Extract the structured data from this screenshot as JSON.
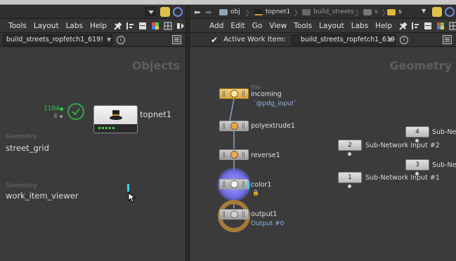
{
  "left_pane": {
    "menu": [
      "Tools",
      "Layout",
      "Labs",
      "Help"
    ],
    "network_path": "build_streets_ropfetch1_619!",
    "context_title": "Objects",
    "nodes": [
      {
        "context": "Geometry",
        "name": "street_grid"
      },
      {
        "context": "Geometry",
        "name": "work_item_viewer"
      }
    ],
    "topnet": {
      "name": "topnet1",
      "count_green": "1184",
      "count_grey": "4"
    }
  },
  "right_pane": {
    "breadcrumbs": [
      "obj",
      "topnet1",
      "build_streets",
      "s",
      "s"
    ],
    "menu": [
      "Add",
      "Edit",
      "Go",
      "View",
      "Tools",
      "Layout",
      "Labs",
      "Help"
    ],
    "active_work_item_label": "Active Work Item:",
    "work_item_value": "build_streets_ropfetch1_619!",
    "context_title": "Geometry",
    "nodes": [
      {
        "name": "incoming",
        "header": "File",
        "sub": "`@pdg_input`"
      },
      {
        "name": "polyextrude1"
      },
      {
        "name": "reverse1"
      },
      {
        "name": "color1"
      },
      {
        "name": "output1",
        "sub": "Output #0"
      }
    ],
    "subnet_inputs": [
      {
        "num": "4",
        "label": "Sub-Netw"
      },
      {
        "num": "2",
        "label": "Sub-Network Input #2"
      },
      {
        "num": "3",
        "label": "Sub-Netw"
      },
      {
        "num": "1",
        "label": "Sub-Network Input #1"
      }
    ]
  },
  "colors": {
    "check_green": "#2fa84a",
    "highlight_cyan": "#3bd1e6",
    "orange_icon": "#e6a640",
    "link_blue": "#8db4e8"
  }
}
